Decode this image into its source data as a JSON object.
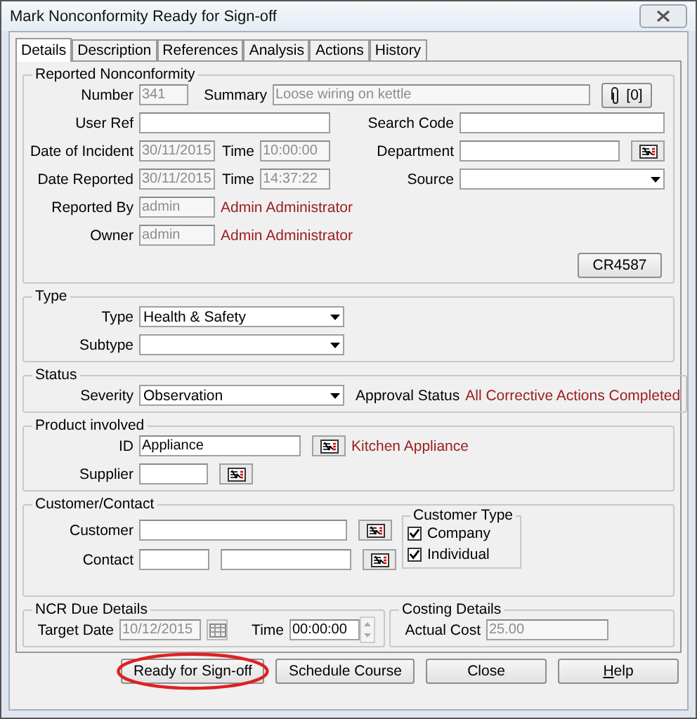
{
  "window": {
    "title": "Mark Nonconformity Ready for Sign-off"
  },
  "tabs": [
    {
      "label": "Details",
      "selected": true
    },
    {
      "label": "Description",
      "selected": false
    },
    {
      "label": "References",
      "selected": false
    },
    {
      "label": "Analysis",
      "selected": false
    },
    {
      "label": "Actions",
      "selected": false
    },
    {
      "label": "History",
      "selected": false
    }
  ],
  "reported_nonconformity": {
    "title": "Reported Nonconformity",
    "number": {
      "label": "Number",
      "value": "341",
      "disabled": true
    },
    "summary": {
      "label": "Summary",
      "value": "Loose wiring on kettle",
      "disabled": true
    },
    "attachments": {
      "count": "[0]"
    },
    "user_ref": {
      "label": "User Ref"
    },
    "search_code": {
      "label": "Search Code"
    },
    "date_of_incident": {
      "label": "Date of Incident",
      "value": "30/11/2015",
      "disabled": true
    },
    "incident_time": {
      "label": "Time",
      "value": "10:00:00",
      "disabled": true
    },
    "department": {
      "label": "Department"
    },
    "date_reported": {
      "label": "Date Reported",
      "value": "30/11/2015",
      "disabled": true
    },
    "reported_time": {
      "label": "Time",
      "value": "14:37:22",
      "disabled": true
    },
    "source": {
      "label": "Source"
    },
    "reported_by": {
      "label": "Reported By",
      "value": "admin",
      "disabled": true,
      "full_name": "Admin Administrator"
    },
    "owner": {
      "label": "Owner",
      "value": "admin",
      "disabled": true,
      "full_name": "Admin Administrator"
    },
    "cr_button": "CR4587"
  },
  "type": {
    "title": "Type",
    "type": {
      "label": "Type",
      "value": "Health & Safety"
    },
    "subtype": {
      "label": "Subtype"
    }
  },
  "status": {
    "title": "Status",
    "severity": {
      "label": "Severity",
      "value": "Observation"
    },
    "approval_status": {
      "label": "Approval Status",
      "value": "All Corrective Actions Completed"
    }
  },
  "product_involved": {
    "title": "Product involved",
    "id": {
      "label": "ID",
      "value": "Appliance",
      "disabled": false,
      "description": "Kitchen Appliance"
    },
    "supplier": {
      "label": "Supplier"
    }
  },
  "customer_contact": {
    "title": "Customer/Contact",
    "customer": {
      "label": "Customer"
    },
    "contact": {
      "label": "Contact"
    },
    "customer_type": {
      "title": "Customer Type",
      "options": [
        {
          "label": "Company",
          "checked": true
        },
        {
          "label": "Individual",
          "checked": true
        }
      ]
    }
  },
  "ncr_due_details": {
    "title": "NCR Due Details",
    "target_date": {
      "label": "Target Date",
      "value": "10/12/2015",
      "disabled": true
    },
    "time": {
      "label": "Time",
      "value": "00:00:00",
      "disabled": false
    }
  },
  "costing_details": {
    "title": "Costing Details",
    "actual_cost": {
      "label": "Actual Cost",
      "value": "25.00",
      "disabled": true
    }
  },
  "buttons": [
    {
      "label": "Ready for Sign-off",
      "highlighted": true
    },
    {
      "label": "Schedule Course",
      "highlighted": false
    },
    {
      "label": "Close",
      "highlighted": false
    },
    {
      "label": "Help",
      "highlighted": false
    }
  ]
}
